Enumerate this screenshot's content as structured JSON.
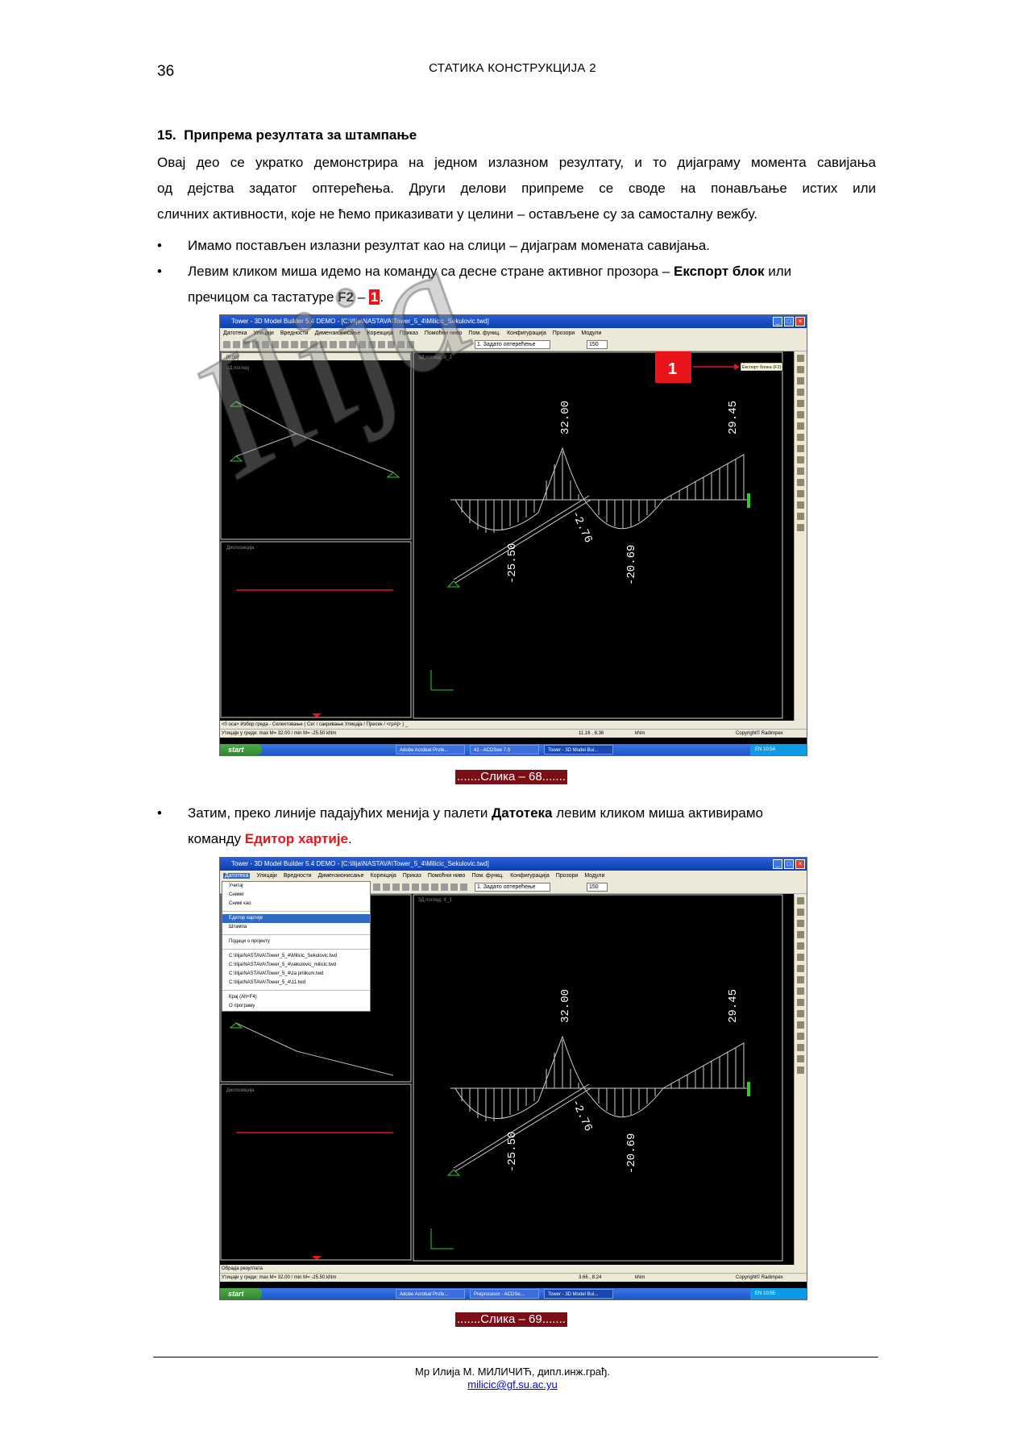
{
  "header": {
    "page_number": "36",
    "running_head": "СТАТИКА КОНСТРУКЦИЈА 2"
  },
  "section": {
    "number": "15.",
    "title": "Припрема резултата за штампање"
  },
  "intro": {
    "line1": "Овај део се укратко демонстрира на једном излазном резултату, и то дијаграму момента савијања",
    "line2": "од дејства задатог оптерећења. Други делови припреме се своде на понављање истих или",
    "line3": "сличних активности, које не ћемо приказивати у целини – остављене су за самосталну вежбу."
  },
  "bullets": {
    "b1": "Имамо постављен излазни резултат као на слици – дијаграм момената савијања.",
    "b2_part1": "Левим кликом миша идемо на команду са десне стране активног прозора – ",
    "b2_bold": "Експорт блок",
    "b2_part2": " или",
    "b2_line2_a": "пречицом са тастатуре ",
    "b2_key": "F2",
    "b2_dash": " – ",
    "b2_marker": "1",
    "b2_end": ".",
    "b3_part1": "Затим, преко линије падајућих менија у палети ",
    "b3_bold": "Датотека",
    "b3_part2": " левим кликом миша активирамо",
    "b3_line2_a": "команду ",
    "b3_red": "Едитор хартије",
    "b3_end": "."
  },
  "figure1": {
    "window_title": "Tower - 3D Model Builder 5.4 DEMO - [C:\\Ilija\\NASTAVA\\Tower_5_4\\Milicic_Sekulovic.twd]",
    "menu": [
      "Датотека",
      "Улицаји",
      "Вредности",
      "Димензионисање",
      "Корекција",
      "Приказ",
      "Помоћни ниво",
      "Пом. функц.",
      "Конфигурација",
      "Прозори",
      "Модули"
    ],
    "load_case": "1. Задато оптерећење",
    "zoom": "150",
    "view_label_left": "[0.00]",
    "panel_3d": "3Д поглед",
    "panel_3d_right": "3Д поглед: Х_1",
    "panel_disp": "Диспозиција",
    "marker": "1",
    "tooltip": "Експорт блока (F2)",
    "values": {
      "v1": "32.00",
      "v2": "29.45",
      "v3": "-2.76",
      "v4": "-20.69",
      "v5": "-25.50"
    },
    "command_line": "<0 оса> Избор греда - Селектовање ( Сег / сакривање Улицаја / Пресек / <грАј> ) _",
    "status_left": "Утицаји у греди: max M= 32.00 / min M= -25.50 kNm",
    "status_coords": "11.16 , 8.36",
    "status_unit": "kNm",
    "status_copy": "Copyright© Radimpex",
    "start": "start",
    "tasks": [
      "Adobe Acrobat Profe...",
      "41 - ACDSee 7.0",
      "Tower - 3D Model Bui..."
    ],
    "tray": "EN  10:54",
    "caption": ".......Слика – 68......."
  },
  "figure2": {
    "window_title": "Tower - 3D Model Builder 5.4 DEMO - [C:\\Ilija\\NASTAVA\\Tower_5_4\\Milicic_Sekulovic.twd]",
    "menu": [
      "Датотека",
      "Улицаји",
      "Вредности",
      "Димензионисање",
      "Корекција",
      "Приказ",
      "Помоћни ниво",
      "Пом. функц.",
      "Конфигурација",
      "Прозори",
      "Модули"
    ],
    "load_case": "1. Задато оптерећење",
    "zoom": "150",
    "panel_3d_right": "3Д поглед: Х_1",
    "panel_disp": "Диспозиција",
    "dropdown": [
      "Учитај",
      "Сними",
      "Снимi као",
      "Едитор хартије",
      "Штампа",
      "Подаци о пројекту",
      "C:\\Ilija\\NASTAVA\\Tower_5_4\\Milicic_Sekulovic.twd",
      "C:\\Ilija\\NASTAVA\\Tower_5_4\\sekulovic_milicic.twd",
      "C:\\Ilija\\NASTAVA\\Tower_5_4\\za prilikum.twd",
      "C:\\Ilija\\NASTAVA\\Tower_5_4\\11.twd",
      "Крај (Alt+F4)",
      "О програму"
    ],
    "values": {
      "v1": "32.00",
      "v2": "29.45",
      "v3": "-2.76",
      "v4": "-20.69",
      "v5": "-25.50"
    },
    "command_line": "Обрада резултата",
    "status_left": "Утицаји у греди: max M= 32.00 / min M= -25.50 kNm",
    "status_coords": "3.66 , 8.24",
    "status_unit": "kNm",
    "status_copy": "Copyright© Radimpex",
    "start": "start",
    "tasks": [
      "Adobe Acrobat Profe...",
      "Preprocesor - ACDSe...",
      "Tower - 3D Model Bui..."
    ],
    "tray": "EN  10:55",
    "caption": ".......Слика – 69......."
  },
  "watermark": "Ilija",
  "footer": {
    "author": "Мр Илија М. МИЛИЧИЋ, дипл.инж.грађ.",
    "email": "milicic@gf.su.ac.yu"
  },
  "colors": {
    "accent_red": "#e8141a",
    "caption_bg": "#7a0f18",
    "link": "#0000ee",
    "diagram_line": "#d0d0d0",
    "support_green": "#2ecc2e"
  }
}
